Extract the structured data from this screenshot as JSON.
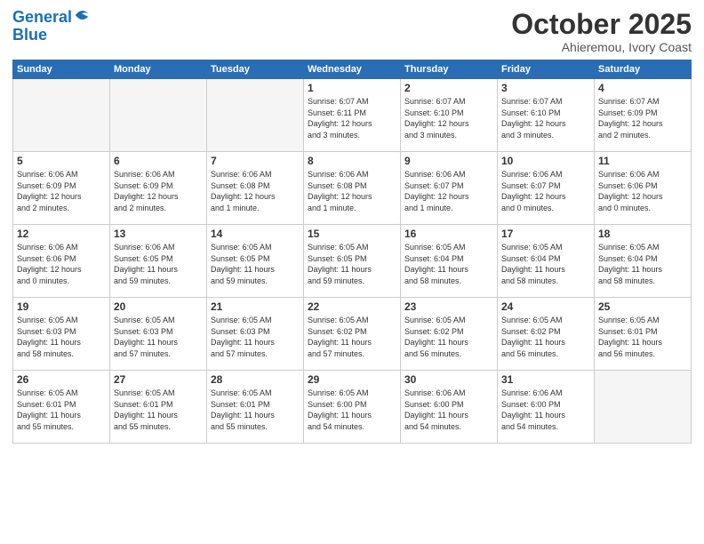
{
  "header": {
    "logo_line1": "General",
    "logo_line2": "Blue",
    "month": "October 2025",
    "location": "Ahieremou, Ivory Coast"
  },
  "weekdays": [
    "Sunday",
    "Monday",
    "Tuesday",
    "Wednesday",
    "Thursday",
    "Friday",
    "Saturday"
  ],
  "weeks": [
    [
      {
        "day": "",
        "info": ""
      },
      {
        "day": "",
        "info": ""
      },
      {
        "day": "",
        "info": ""
      },
      {
        "day": "1",
        "info": "Sunrise: 6:07 AM\nSunset: 6:11 PM\nDaylight: 12 hours\nand 3 minutes."
      },
      {
        "day": "2",
        "info": "Sunrise: 6:07 AM\nSunset: 6:10 PM\nDaylight: 12 hours\nand 3 minutes."
      },
      {
        "day": "3",
        "info": "Sunrise: 6:07 AM\nSunset: 6:10 PM\nDaylight: 12 hours\nand 3 minutes."
      },
      {
        "day": "4",
        "info": "Sunrise: 6:07 AM\nSunset: 6:09 PM\nDaylight: 12 hours\nand 2 minutes."
      }
    ],
    [
      {
        "day": "5",
        "info": "Sunrise: 6:06 AM\nSunset: 6:09 PM\nDaylight: 12 hours\nand 2 minutes."
      },
      {
        "day": "6",
        "info": "Sunrise: 6:06 AM\nSunset: 6:09 PM\nDaylight: 12 hours\nand 2 minutes."
      },
      {
        "day": "7",
        "info": "Sunrise: 6:06 AM\nSunset: 6:08 PM\nDaylight: 12 hours\nand 1 minute."
      },
      {
        "day": "8",
        "info": "Sunrise: 6:06 AM\nSunset: 6:08 PM\nDaylight: 12 hours\nand 1 minute."
      },
      {
        "day": "9",
        "info": "Sunrise: 6:06 AM\nSunset: 6:07 PM\nDaylight: 12 hours\nand 1 minute."
      },
      {
        "day": "10",
        "info": "Sunrise: 6:06 AM\nSunset: 6:07 PM\nDaylight: 12 hours\nand 0 minutes."
      },
      {
        "day": "11",
        "info": "Sunrise: 6:06 AM\nSunset: 6:06 PM\nDaylight: 12 hours\nand 0 minutes."
      }
    ],
    [
      {
        "day": "12",
        "info": "Sunrise: 6:06 AM\nSunset: 6:06 PM\nDaylight: 12 hours\nand 0 minutes."
      },
      {
        "day": "13",
        "info": "Sunrise: 6:06 AM\nSunset: 6:05 PM\nDaylight: 11 hours\nand 59 minutes."
      },
      {
        "day": "14",
        "info": "Sunrise: 6:05 AM\nSunset: 6:05 PM\nDaylight: 11 hours\nand 59 minutes."
      },
      {
        "day": "15",
        "info": "Sunrise: 6:05 AM\nSunset: 6:05 PM\nDaylight: 11 hours\nand 59 minutes."
      },
      {
        "day": "16",
        "info": "Sunrise: 6:05 AM\nSunset: 6:04 PM\nDaylight: 11 hours\nand 58 minutes."
      },
      {
        "day": "17",
        "info": "Sunrise: 6:05 AM\nSunset: 6:04 PM\nDaylight: 11 hours\nand 58 minutes."
      },
      {
        "day": "18",
        "info": "Sunrise: 6:05 AM\nSunset: 6:04 PM\nDaylight: 11 hours\nand 58 minutes."
      }
    ],
    [
      {
        "day": "19",
        "info": "Sunrise: 6:05 AM\nSunset: 6:03 PM\nDaylight: 11 hours\nand 58 minutes."
      },
      {
        "day": "20",
        "info": "Sunrise: 6:05 AM\nSunset: 6:03 PM\nDaylight: 11 hours\nand 57 minutes."
      },
      {
        "day": "21",
        "info": "Sunrise: 6:05 AM\nSunset: 6:03 PM\nDaylight: 11 hours\nand 57 minutes."
      },
      {
        "day": "22",
        "info": "Sunrise: 6:05 AM\nSunset: 6:02 PM\nDaylight: 11 hours\nand 57 minutes."
      },
      {
        "day": "23",
        "info": "Sunrise: 6:05 AM\nSunset: 6:02 PM\nDaylight: 11 hours\nand 56 minutes."
      },
      {
        "day": "24",
        "info": "Sunrise: 6:05 AM\nSunset: 6:02 PM\nDaylight: 11 hours\nand 56 minutes."
      },
      {
        "day": "25",
        "info": "Sunrise: 6:05 AM\nSunset: 6:01 PM\nDaylight: 11 hours\nand 56 minutes."
      }
    ],
    [
      {
        "day": "26",
        "info": "Sunrise: 6:05 AM\nSunset: 6:01 PM\nDaylight: 11 hours\nand 55 minutes."
      },
      {
        "day": "27",
        "info": "Sunrise: 6:05 AM\nSunset: 6:01 PM\nDaylight: 11 hours\nand 55 minutes."
      },
      {
        "day": "28",
        "info": "Sunrise: 6:05 AM\nSunset: 6:01 PM\nDaylight: 11 hours\nand 55 minutes."
      },
      {
        "day": "29",
        "info": "Sunrise: 6:05 AM\nSunset: 6:00 PM\nDaylight: 11 hours\nand 54 minutes."
      },
      {
        "day": "30",
        "info": "Sunrise: 6:06 AM\nSunset: 6:00 PM\nDaylight: 11 hours\nand 54 minutes."
      },
      {
        "day": "31",
        "info": "Sunrise: 6:06 AM\nSunset: 6:00 PM\nDaylight: 11 hours\nand 54 minutes."
      },
      {
        "day": "",
        "info": ""
      }
    ]
  ]
}
